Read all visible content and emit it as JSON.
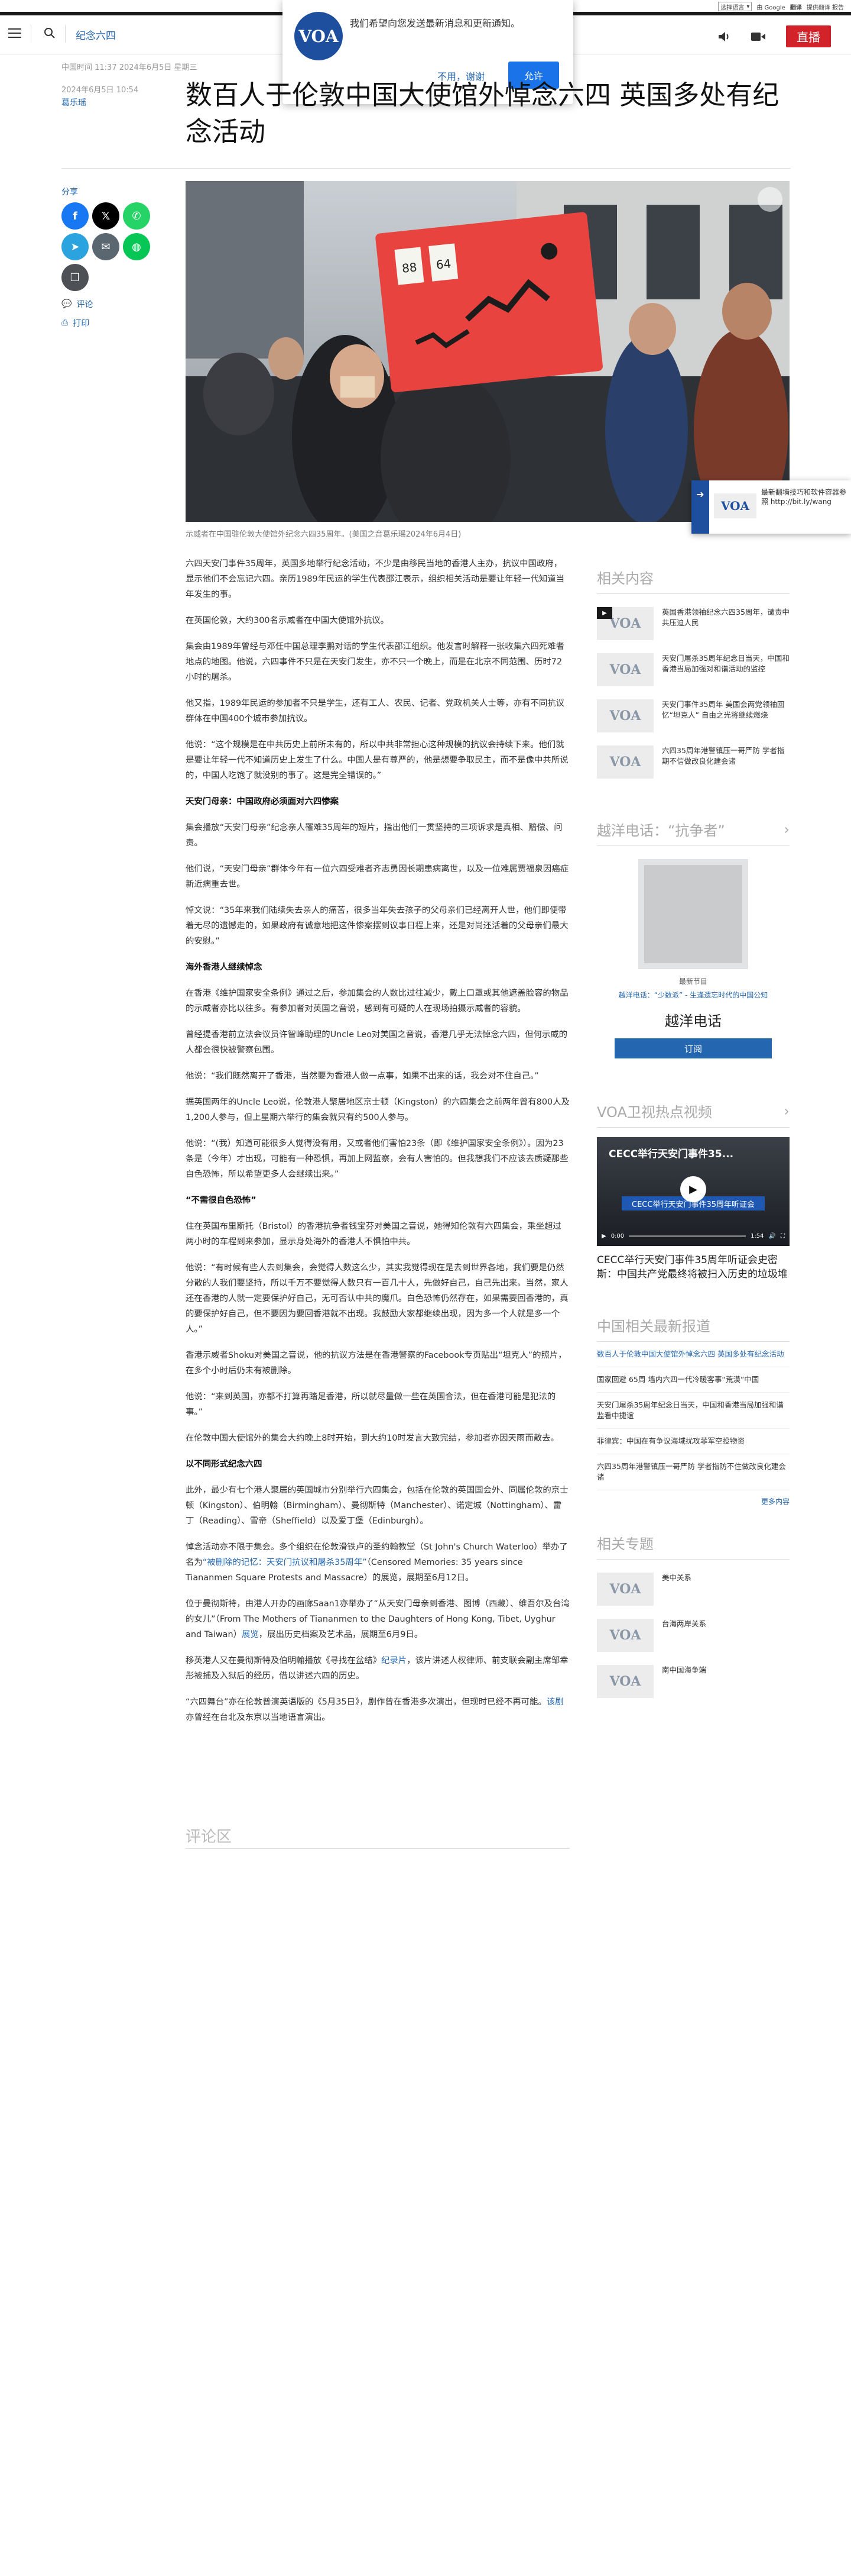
{
  "lang_bar": {
    "select": "选择语言",
    "powered": "由 Google",
    "translate": "翻译",
    "report": "提供翻译 报告"
  },
  "header": {
    "section": "纪念六四",
    "live": "直播"
  },
  "notification": {
    "logo": "VOA",
    "message": "我们希望向您发送最新消息和更新通知。",
    "decline": "不用，谢谢",
    "accept": "允许"
  },
  "meta": {
    "dateline": "中国时间 11:37 2024年6月5日 星期三",
    "dateline2": "2024年6月5日 10:54",
    "byline": "葛乐瑶"
  },
  "title": "数百人于伦敦中国大使馆外悼念六四 英国多处有纪念活动",
  "share": {
    "label": "分享",
    "comment": "评论",
    "print": "打印"
  },
  "hero": {
    "caption": "示威者在中国驻伦敦大使馆外纪念六四35周年。(美国之音葛乐瑶2024年6月4日)",
    "sign_numbers": [
      "88",
      "64"
    ]
  },
  "float_card": {
    "logo": "VOA",
    "text": "最新翻墙技巧和软件容器参照 http://bit.ly/wang"
  },
  "article": {
    "p1": "六四天安门事件35周年，英国多地举行纪念活动，不少是由移民当地的香港人主办，抗议中国政府，显示他们不会忘记六四。亲历1989年民运的学生代表邵江表示，组织相关活动是要让年轻一代知道当年发生的事。",
    "p2": "在英国伦敦，大约300名示威者在中国大使馆外抗议。",
    "p3": "集会由1989年曾经与邓任中国总理李鹏对话的学生代表邵江组织。他发言时解释一张收集六四死难者地点的地图。他说，六四事件不只是在天安门发生，亦不只一个晚上，而是在北京不同范围、历时72小时的屠杀。",
    "p4": "他又指，1989年民运的参加者不只是学生，还有工人、农民、记者、党政机关人士等，亦有不同抗议群体在中国400个城市参加抗议。",
    "p5": "他说：“这个规模是在中共历史上前所未有的，所以中共非常担心这种规模的抗议会持续下来。他们就是要让年轻一代不知道历史上发生了什么。中国人是有尊严的，他是想要争取民主，而不是像中共所说的，中国人吃饱了就没别的事了。这是完全错误的。”",
    "h1": "天安门母亲：中国政府必须面对六四惨案",
    "p6": "集会播放“天安门母亲”纪念亲人罹难35周年的短片，指出他们一贯坚持的三项诉求是真相、赔偿、问责。",
    "p7": "他们说，“天安门母亲”群体今年有一位六四受难者齐志勇因长期患病离世，以及一位难属贾福泉因癌症新近病重去世。",
    "p8": "悼文说：“35年来我们陆续失去亲人的痛苦，很多当年失去孩子的父母亲们已经离开人世，他们即便带着无尽的遗憾走的，如果政府有诚意地把这件惨案摆到议事日程上来，还是对尚还活着的父母亲们最大的安慰。”",
    "h2": "海外香港人继续悼念",
    "p9": "在香港《维护国家安全条例》通过之后，参加集会的人数比过往减少，戴上口罩或其他遮盖脸容的物品的示威者亦比以往多。有参加者对英国之音说，感到有可疑的人在现场拍摄示威者的容貌。",
    "p10": "曾经提香港前立法会议员许智峰助理的Uncle Leo对美国之音说，香港几乎无法悼念六四，但何示威的人都会很快被警察包围。",
    "p11": "他说：“我们既然离开了香港，当然要为香港人做一点事，如果不出来的话，我会对不住自己。”",
    "p12": "据英国两年的Uncle Leo说，伦敦港人聚居地区京士顿（Kingston）的六四集会之前两年曾有800人及1,200人参与，但上星期六举行的集会就只有约500人参与。",
    "p13": "他说：“(我）知道可能很多人觉得没有用，又或者他们害怕23条（即《维护国家安全条例》）。因为23条是（今年）才出现，可能有一种恐惧，再加上网监察，会有人害怕的。但我想我们不应该去质疑那些自色恐怖，所以希望更多人会继续出来。”",
    "h3": "“不需很自色恐怖”",
    "p14": "住在英国布里斯托（Bristol）的香港抗争者钱宝芬对美国之音说，她得知伦敦有六四集会，乘坐超过两小时的车程到来参加，显示身处海外的香港人不惧怕中共。",
    "p15": "他说：“有时候有些人去到集会，会觉得人数这么少，其实我觉得现在是去到世界各地，我们要是仍然分散的人我们要坚持，所以千万不要觉得人数只有一百几十人，先做好自己，自己先出来。当然，家人还在香港的人就一定要保护好自己，无可否认中共的魔爪。白色恐怖仍然存在，如果需要回香港的，真的要保护好自己，但不要因为要回香港就不出现。我鼓励大家都继续出现，因为多一个人就是多一个人。”",
    "p16": "香港示威者Shoku对美国之音说，他的抗议方法是在香港警察的Facebook专页贴出“坦克人”的照片，在多个小时后仍未有被删除。",
    "p17": "他说：“来到英国，亦都不打算再踏足香港，所以就尽量做一些在英国合法，但在香港可能是犯法的事。”",
    "p18": "在伦敦中国大使馆外的集会大约晚上8时开始，到大约10时发言大致完结，参加者亦因天雨而散去。",
    "h4": "以不同形式纪念六四",
    "p19": "此外，最少有七个港人聚居的英国城市分别举行六四集会，包括在伦敦的英国国会外、同属伦敦的京士顿（Kingston）、伯明翰（Birmingham）、曼彻斯特（Manchester）、诺定城（Nottingham）、雷丁（Reading）、雪帝（Sheffield）以及爱丁堡（Edinburgh）。",
    "p20a": "悼念活动亦不限于集会。多个组织在伦敦滑铁卢的圣约翰教堂（St John's Church Waterloo）举办了名为",
    "p20link": "“被删除的记忆：天安门抗议和屠杀35周年”",
    "p20b": "（Censored Memories: 35 years since Tiananmen Square Protests and Massacre）的展览，展期至6月12日。",
    "p21a": "位于曼彻斯特，由港人开办的画廊Saan1亦举办了“从天安门母亲到香港、图博（西藏）、维吾尔及台湾的女儿”（From The Mothers of Tiananmen to the Daughters of Hong Kong, Tibet, Uyghur and Taiwan）",
    "p21link": "展览",
    "p21b": "，展出历史档案及艺术品，展期至6月9日。",
    "p22a": "移英港人又在曼彻斯特及伯明翰播放《寻找在盆结》",
    "p22link": "纪录片",
    "p22b": "，该片讲述人权律师、前支联会副主席邹幸彤被捕及入狱后的经历，借以讲述六四的历史。",
    "p23a": "“六四舞台”亦在伦敦普演英语版的《5月35日》，剧作曾在香港多次演出，但现时已经不再可能。",
    "p23link": "该剧",
    "p23b": "亦曾经在台北及东京以当地语言演出。"
  },
  "comments": {
    "heading": "评论区"
  },
  "related": {
    "heading": "相关内容",
    "items": [
      {
        "thumb": "VOA",
        "title": "英国香港领袖纪念六四35周年，谴责中共压迫人民"
      },
      {
        "thumb": "VOA",
        "title": "天安门屠杀35周年纪念日当天，中国和香港当局加强对和谐活动的监控"
      },
      {
        "thumb": "VOA",
        "title": "天安门事件35周年 美国会两党领袖回忆“坦克人” 自由之光将继续燃烧"
      },
      {
        "thumb": "VOA",
        "title": "六四35周年港警镇压一哥严防 学者指期不信做改良化建会诸"
      }
    ]
  },
  "yueyang": {
    "heading": "越洋电话：“抗争者”",
    "label": "最新节目",
    "sub": "越洋电话：“少数派” - 生逢遗忘时代的中国公知",
    "name": "越洋电话",
    "subscribe": "订阅"
  },
  "video": {
    "heading": "VOA卫视热点视频",
    "video_title": "CECC举行天安门事件35...",
    "banner": "CECC举行天安门事件35周年听证会",
    "time": "0:00",
    "duration": "1:54",
    "caption": "CECC举行天安门事件35周年听证会史密斯：中国共产党最终将被扫入历史的垃圾堆"
  },
  "latest": {
    "heading": "中国相关最新报道",
    "items": [
      "数百人于伦敦中国大使馆外悼念六四 英国多处有纪念活动",
      "国家回避 65周 墙内六四一代冷暖客事“荒漠”中国",
      "天安门屠杀35周年纪念日当天，中国和香港当局加强和谐监看中捷谊",
      "菲律宾：中国在有争议海域扰攻菲军空投物资",
      "六四35周年港警镇压一哥严防 学者指防不住做改良化建会诸"
    ],
    "more": "更多内容"
  },
  "topics": {
    "heading": "相关专题",
    "items": [
      {
        "thumb": "VOA",
        "title": "美中关系"
      },
      {
        "thumb": "VOA",
        "title": "台海两岸关系"
      },
      {
        "thumb": "VOA",
        "title": "南中国海争端"
      }
    ]
  },
  "colors": {
    "accent": "#2467b0",
    "live": "#d2232a",
    "voa_blue": "#1d4f9e",
    "sign": "#e8433f"
  },
  "icons": [
    "menu-icon",
    "search-icon",
    "audio-icon",
    "video-icon",
    "facebook-icon",
    "x-icon",
    "whatsapp-icon",
    "telegram-icon",
    "email-icon",
    "line-icon",
    "copy-link-icon",
    "comment-icon",
    "print-icon",
    "expand-icon",
    "play-icon"
  ]
}
